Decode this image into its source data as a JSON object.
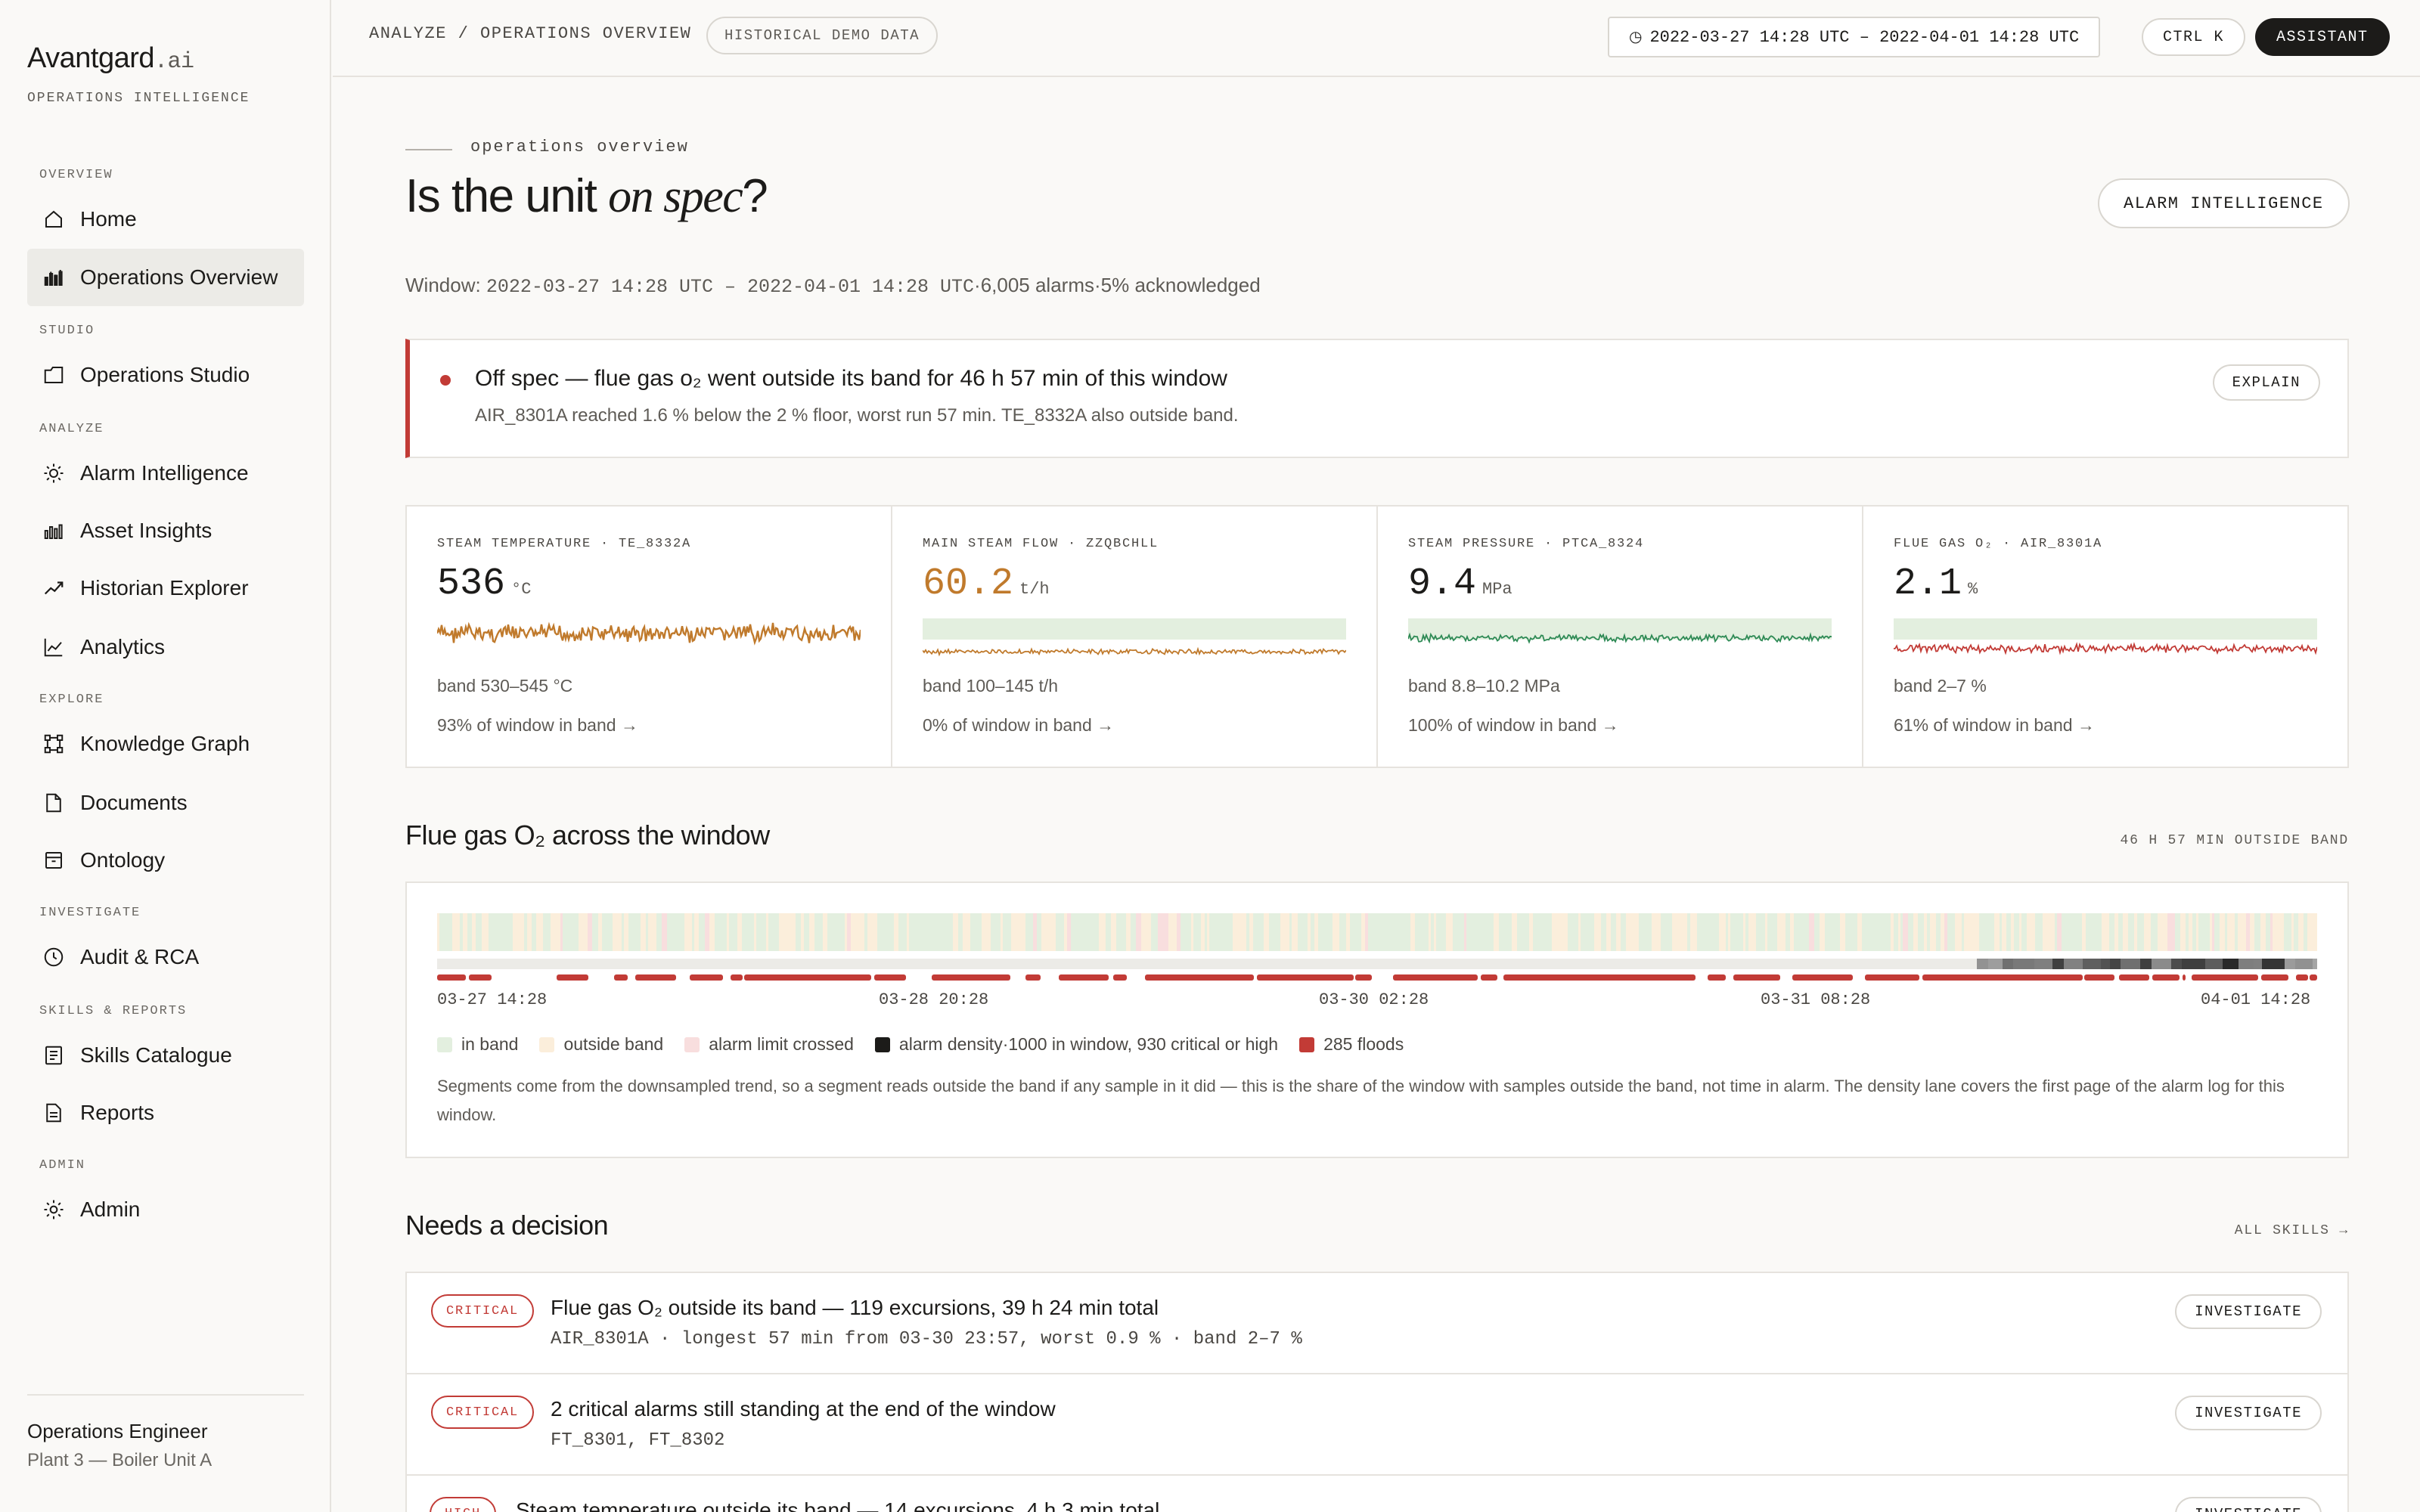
{
  "brand": {
    "name": "Avantgard",
    "suffix": ".ai",
    "subtitle": "OPERATIONS INTELLIGENCE"
  },
  "sidebar": {
    "sections": [
      {
        "label": "OVERVIEW"
      },
      {
        "label": "STUDIO"
      },
      {
        "label": "ANALYZE"
      },
      {
        "label": "EXPLORE"
      },
      {
        "label": "INVESTIGATE"
      },
      {
        "label": "SKILLS & REPORTS"
      },
      {
        "label": "ADMIN"
      }
    ],
    "items": [
      {
        "label": "Home",
        "icon": "home-icon",
        "active": false
      },
      {
        "label": "Operations Overview",
        "icon": "bar-chart-icon",
        "active": true
      },
      {
        "label": "Operations Studio",
        "icon": "folder-icon",
        "active": false
      },
      {
        "label": "Alarm Intelligence",
        "icon": "sun-icon",
        "active": false
      },
      {
        "label": "Asset Insights",
        "icon": "bar-chart-icon",
        "active": false
      },
      {
        "label": "Historian Explorer",
        "icon": "trend-icon",
        "active": false
      },
      {
        "label": "Analytics",
        "icon": "line-chart-icon",
        "active": false
      },
      {
        "label": "Knowledge Graph",
        "icon": "graph-icon",
        "active": false
      },
      {
        "label": "Documents",
        "icon": "document-icon",
        "active": false
      },
      {
        "label": "Ontology",
        "icon": "archive-icon",
        "active": false
      },
      {
        "label": "Audit & RCA",
        "icon": "clock-icon",
        "active": false
      },
      {
        "label": "Skills Catalogue",
        "icon": "list-icon",
        "active": false
      },
      {
        "label": "Reports",
        "icon": "report-icon",
        "active": false
      },
      {
        "label": "Admin",
        "icon": "gear-icon",
        "active": false
      }
    ],
    "user": {
      "name": "Operations Engineer",
      "role": "Plant 3 — Boiler Unit A"
    }
  },
  "topbar": {
    "breadcrumb": "ANALYZE / OPERATIONS OVERVIEW",
    "demo_badge": "HISTORICAL DEMO DATA",
    "range": "2022-03-27 14:28 UTC – 2022-04-01 14:28 UTC",
    "range_icon": "◷",
    "shortcut": "CTRL K",
    "assistant": "ASSISTANT"
  },
  "header": {
    "eyebrow": "operations overview",
    "title_pre": "Is the unit ",
    "title_em": "on spec",
    "title_post": "?",
    "action": "ALARM INTELLIGENCE",
    "window_label": "Window: ",
    "window_range": "2022-03-27 14:28 UTC – 2022-04-01 14:28 UTC",
    "window_stats": "·6,005 alarms·5% acknowledged"
  },
  "alert": {
    "title": "Off spec — flue gas o₂ went outside its band for 46 h 57 min of this window",
    "detail": "AIR_8301A reached 1.6 % below the 2 % floor, worst run 57 min. TE_8332A also outside band.",
    "action": "EXPLAIN"
  },
  "kpis": [
    {
      "label": "STEAM TEMPERATURE · TE_8332A",
      "value": "536",
      "unit": "°C",
      "band": "band 530–545 °C",
      "link": "93% of window in band →",
      "color": "#c07a2c",
      "in_band_pct": 93
    },
    {
      "label": "MAIN STEAM FLOW · ZZQBCHLL",
      "value": "60.2",
      "unit": "t/h",
      "band": "band 100–145 t/h",
      "link": "0% of window in band →",
      "color": "#c07a2c",
      "in_band_pct": 0
    },
    {
      "label": "STEAM PRESSURE · PTCA_8324",
      "value": "9.4",
      "unit": "MPa",
      "band": "band 8.8–10.2 MPa",
      "link": "100% of window in band →",
      "color": "#2e8a55",
      "in_band_pct": 100
    },
    {
      "label": "FLUE GAS O₂ · AIR_8301A",
      "value": "2.1",
      "unit": "%",
      "band": "band 2–7 %",
      "link": "61% of window in band →",
      "color": "#c23b36",
      "in_band_pct": 61
    }
  ],
  "flue": {
    "title": "Flue gas O₂ across the window",
    "meta": "46 H 57 MIN OUTSIDE BAND",
    "ticks": [
      "03-27 14:28",
      "03-28 20:28",
      "03-30 02:28",
      "03-31 08:28",
      "04-01 14:28"
    ],
    "legend": [
      {
        "label": "in band",
        "color": "#e3efdf"
      },
      {
        "label": "outside band",
        "color": "#fbeedb"
      },
      {
        "label": "alarm limit crossed",
        "color": "#f8dede"
      },
      {
        "label": "alarm density·1000 in window, 930 critical or high",
        "color": "#1c1b19"
      },
      {
        "label": "285 floods",
        "color": "#c23b36"
      }
    ],
    "note": "Segments come from the downsampled trend, so a segment reads outside the band if any sample in it did — this is the share of the window with samples outside the band, not time in alarm. The density lane covers the first page of the alarm log for this window."
  },
  "decisions": {
    "title": "Needs a decision",
    "all_link": "ALL SKILLS →",
    "rows": [
      {
        "severity": "CRITICAL",
        "title": "Flue gas O₂ outside its band — 119 excursions, 39 h 24 min total",
        "detail": "AIR_8301A · longest 57 min from 03-30 23:57, worst 0.9 % · band 2–7 %",
        "action": "INVESTIGATE"
      },
      {
        "severity": "CRITICAL",
        "title": "2 critical alarms still standing at the end of the window",
        "detail": "FT_8301, FT_8302",
        "action": "INVESTIGATE"
      },
      {
        "severity": "HIGH",
        "title": "Steam temperature outside its band — 14 excursions, 4 h 3 min total",
        "detail": "",
        "action": "INVESTIGATE"
      }
    ]
  }
}
